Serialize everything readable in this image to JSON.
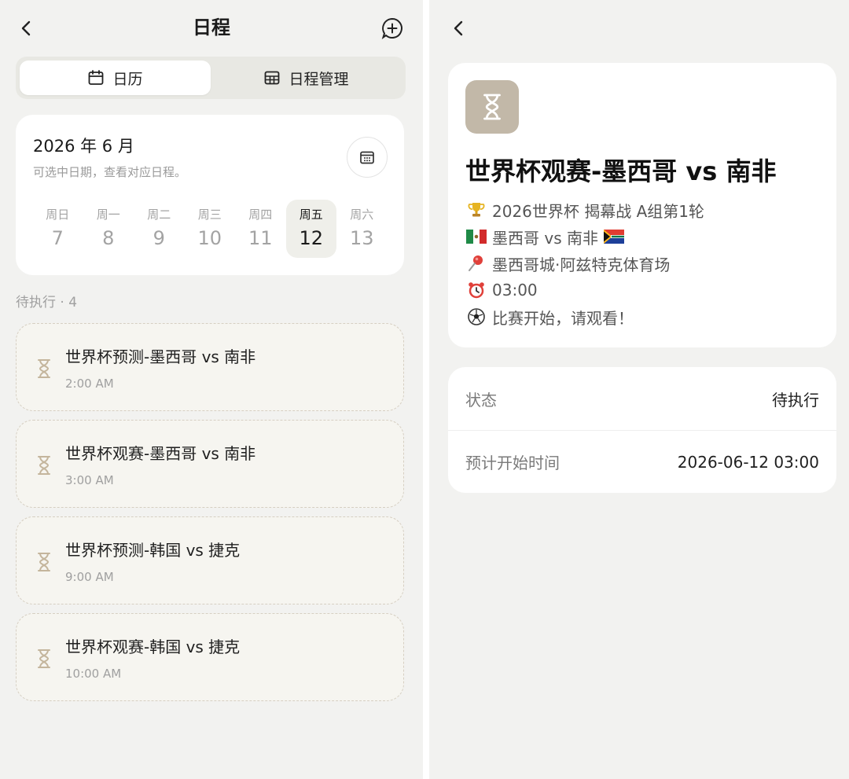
{
  "schedule": {
    "title": "日程",
    "tabs": [
      {
        "label": "日历",
        "icon": "calendar-icon",
        "active": true
      },
      {
        "label": "日程管理",
        "icon": "grid-icon",
        "active": false
      }
    ],
    "calendar": {
      "month": "2026 年 6 月",
      "hint": "可选中日期，查看对应日程。",
      "days": [
        {
          "weekday": "周日",
          "date": "7"
        },
        {
          "weekday": "周一",
          "date": "8"
        },
        {
          "weekday": "周二",
          "date": "9"
        },
        {
          "weekday": "周三",
          "date": "10"
        },
        {
          "weekday": "周四",
          "date": "11"
        },
        {
          "weekday": "周五",
          "date": "12"
        },
        {
          "weekday": "周六",
          "date": "13"
        }
      ],
      "selected": "12"
    },
    "section_label": "待执行 · 4",
    "tasks": [
      {
        "title": "世界杯预测-墨西哥 vs 南非",
        "time": "2:00 AM"
      },
      {
        "title": "世界杯观赛-墨西哥 vs 南非",
        "time": "3:00 AM"
      },
      {
        "title": "世界杯预测-韩国 vs 捷克",
        "time": "9:00 AM"
      },
      {
        "title": "世界杯观赛-韩国 vs 捷克",
        "time": "10:00 AM"
      }
    ]
  },
  "detail": {
    "title": "世界杯观赛-墨西哥 vs 南非",
    "lines": [
      {
        "icon": "trophy-icon",
        "text": "2026世界杯 揭幕战 A组第1轮"
      },
      {
        "icon": "mexico-flag-icon",
        "text": "墨西哥 vs 南非",
        "trail_icon": "south-africa-flag-icon"
      },
      {
        "icon": "pin-icon",
        "text": "墨西哥城·阿兹特克体育场"
      },
      {
        "icon": "alarm-clock-icon",
        "text": "03:00"
      },
      {
        "icon": "soccer-ball-icon",
        "text": "比赛开始，请观看！"
      }
    ],
    "status_label": "状态",
    "status_value": "待执行",
    "start_label": "预计开始时间",
    "start_value": "2026-06-12 03:00"
  },
  "colors": {
    "background": "#f2f2f0",
    "card": "#ffffff",
    "accent_badge": "#c2b8a8",
    "hourglass": "#c4b59c",
    "task_border": "#d6cfc2"
  }
}
